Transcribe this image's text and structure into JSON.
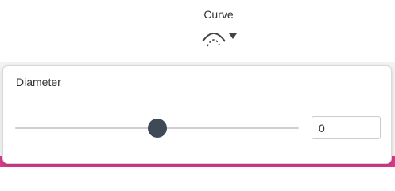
{
  "toolbar": {
    "curve": {
      "label": "Curve",
      "icon": "curve-arc-icon",
      "dropdown_icon": "caret-down-icon"
    }
  },
  "popover": {
    "diameter": {
      "label": "Diameter",
      "slider_fraction": 0.5,
      "value": "0"
    }
  },
  "colors": {
    "thumb": "#3f4a57",
    "track": "#cfcfcf",
    "accent_strip": "#d01a7a"
  }
}
